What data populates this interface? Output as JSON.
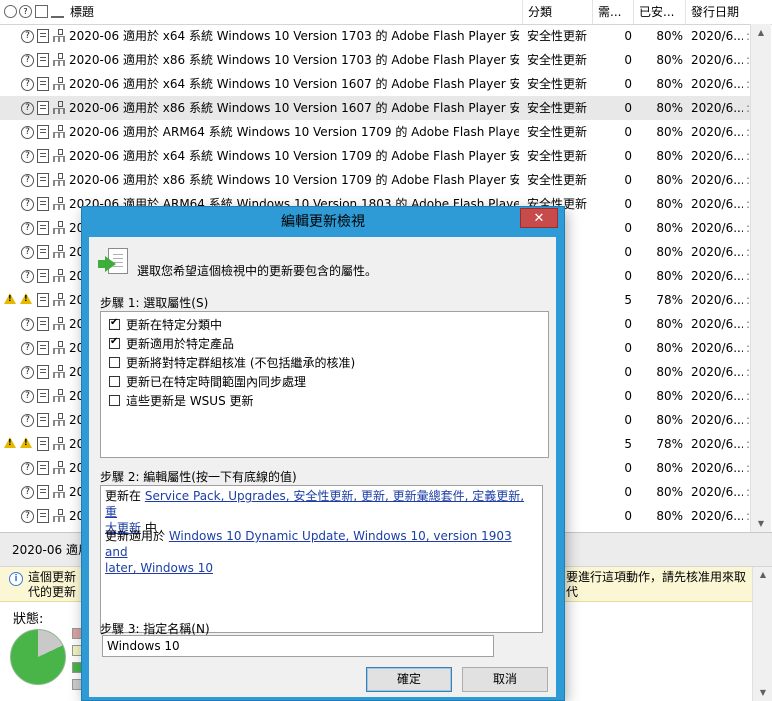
{
  "list": {
    "columns": {
      "title": "標題",
      "classification": "分類",
      "needed": "需...",
      "installed": "已安...",
      "release_date": "發行日期"
    },
    "rows": [
      {
        "title": "2020-06 適用於 x64 系統 Windows 10 Version 1703 的 Adobe Flash Player 安全...",
        "classification": "安全性更新",
        "needed": "0",
        "installed": "80%",
        "date": "2020/6...",
        "warn": false,
        "selected": false
      },
      {
        "title": "2020-06 適用於 x86 系統 Windows 10 Version 1703 的 Adobe Flash Player 安全...",
        "classification": "安全性更新",
        "needed": "0",
        "installed": "80%",
        "date": "2020/6...",
        "warn": false,
        "selected": false
      },
      {
        "title": "2020-06 適用於 x64 系統 Windows 10 Version 1607 的 Adobe Flash Player 安全...",
        "classification": "安全性更新",
        "needed": "0",
        "installed": "80%",
        "date": "2020/6...",
        "warn": false,
        "selected": false
      },
      {
        "title": "2020-06 適用於 x86 系統 Windows 10 Version 1607 的 Adobe Flash Player 安全...",
        "classification": "安全性更新",
        "needed": "0",
        "installed": "80%",
        "date": "2020/6...",
        "warn": false,
        "selected": true
      },
      {
        "title": "2020-06 適用於 ARM64 系統 Windows 10 Version 1709 的 Adobe Flash Player ...",
        "classification": "安全性更新",
        "needed": "0",
        "installed": "80%",
        "date": "2020/6...",
        "warn": false,
        "selected": false
      },
      {
        "title": "2020-06 適用於 x64 系統 Windows 10 Version 1709 的 Adobe Flash Player 安全...",
        "classification": "安全性更新",
        "needed": "0",
        "installed": "80%",
        "date": "2020/6...",
        "warn": false,
        "selected": false
      },
      {
        "title": "2020-06 適用於 x86 系統 Windows 10 Version 1709 的 Adobe Flash Player 安全...",
        "classification": "安全性更新",
        "needed": "0",
        "installed": "80%",
        "date": "2020/6...",
        "warn": false,
        "selected": false
      },
      {
        "title": "2020-06 適用於 ARM64 系統 Windows 10 Version 1803 的 Adobe Flash Player ...",
        "classification": "安全性更新",
        "needed": "0",
        "installed": "80%",
        "date": "2020/6...",
        "warn": false,
        "selected": false
      },
      {
        "title": "20",
        "classification": "新",
        "needed": "0",
        "installed": "80%",
        "date": "2020/6...",
        "warn": false,
        "selected": false
      },
      {
        "title": "20",
        "classification": "新",
        "needed": "0",
        "installed": "80%",
        "date": "2020/6...",
        "warn": false,
        "selected": false
      },
      {
        "title": "20",
        "classification": "新",
        "needed": "0",
        "installed": "80%",
        "date": "2020/6...",
        "warn": false,
        "selected": false
      },
      {
        "title": "20",
        "classification": "新",
        "needed": "5",
        "installed": "78%",
        "date": "2020/6...",
        "warn": true,
        "selected": false
      },
      {
        "title": "20",
        "classification": "新",
        "needed": "0",
        "installed": "80%",
        "date": "2020/6...",
        "warn": false,
        "selected": false
      },
      {
        "title": "20",
        "classification": "新",
        "needed": "0",
        "installed": "80%",
        "date": "2020/6...",
        "warn": false,
        "selected": false
      },
      {
        "title": "20",
        "classification": "新",
        "needed": "0",
        "installed": "80%",
        "date": "2020/6...",
        "warn": false,
        "selected": false
      },
      {
        "title": "20",
        "classification": "新",
        "needed": "0",
        "installed": "80%",
        "date": "2020/6...",
        "warn": false,
        "selected": false
      },
      {
        "title": "20",
        "classification": "新",
        "needed": "0",
        "installed": "80%",
        "date": "2020/6...",
        "warn": false,
        "selected": false
      },
      {
        "title": "20",
        "classification": "新",
        "needed": "5",
        "installed": "78%",
        "date": "2020/6...",
        "warn": true,
        "selected": false
      },
      {
        "title": "20",
        "classification": "新",
        "needed": "0",
        "installed": "80%",
        "date": "2020/6...",
        "warn": false,
        "selected": false
      },
      {
        "title": "20",
        "classification": "新",
        "needed": "0",
        "installed": "80%",
        "date": "2020/6...",
        "warn": false,
        "selected": false
      },
      {
        "title": "20",
        "classification": "新",
        "needed": "0",
        "installed": "80%",
        "date": "2020/6...",
        "warn": false,
        "selected": false
      }
    ]
  },
  "detail": {
    "title_prefix": "2020-06 適用",
    "note_left_line1": "這個更新",
    "note_left_line2": "代的更新",
    "note_right_line1": "要進行這項動作，請先核准用來取",
    "note_right_line2": "代",
    "status_label": "狀態:",
    "pie_installed_fraction": 0.82,
    "legend_colors": [
      "#d9a3a3",
      "#f2f2c4",
      "#49b548",
      "#cccccc"
    ]
  },
  "dialog": {
    "title": "編輯更新檢視",
    "close_glyph": "✕",
    "intro": "選取您希望這個檢視中的更新要包含的屬性。",
    "step1_label": "步驟 1: 選取屬性(S)",
    "properties": [
      {
        "label": "更新在特定分類中",
        "checked": true
      },
      {
        "label": "更新適用於特定產品",
        "checked": true
      },
      {
        "label": "更新將對特定群組核准 (不包括繼承的核准)",
        "checked": false
      },
      {
        "label": "更新已在特定時間範圍內同步處理",
        "checked": false
      },
      {
        "label": "這些更新是 WSUS 更新",
        "checked": false
      }
    ],
    "step2_label": "步驟 2: 編輯屬性(按一下有底線的值)",
    "criteria1_prefix": "更新在 ",
    "criteria1_link_line1": "Service Pack, Upgrades, 安全性更新, 更新, 更新彙總套件, 定義更新, 重",
    "criteria1_link_line2": "大更新",
    "criteria1_suffix": " 中",
    "criteria2_prefix": "更新適用於 ",
    "criteria2_link_line1": "Windows 10 Dynamic Update, Windows 10, version 1903 and",
    "criteria2_link_line2": "later, Windows 10",
    "step3_label": "步驟 3: 指定名稱(N)",
    "name_value": "Windows 10",
    "ok_label": "確定",
    "cancel_label": "取消"
  },
  "colors": {
    "dialog_frame": "#2f9bd6",
    "close_button": "#c74b4b",
    "link": "#1d3ea6",
    "warning": "#e8b800"
  }
}
